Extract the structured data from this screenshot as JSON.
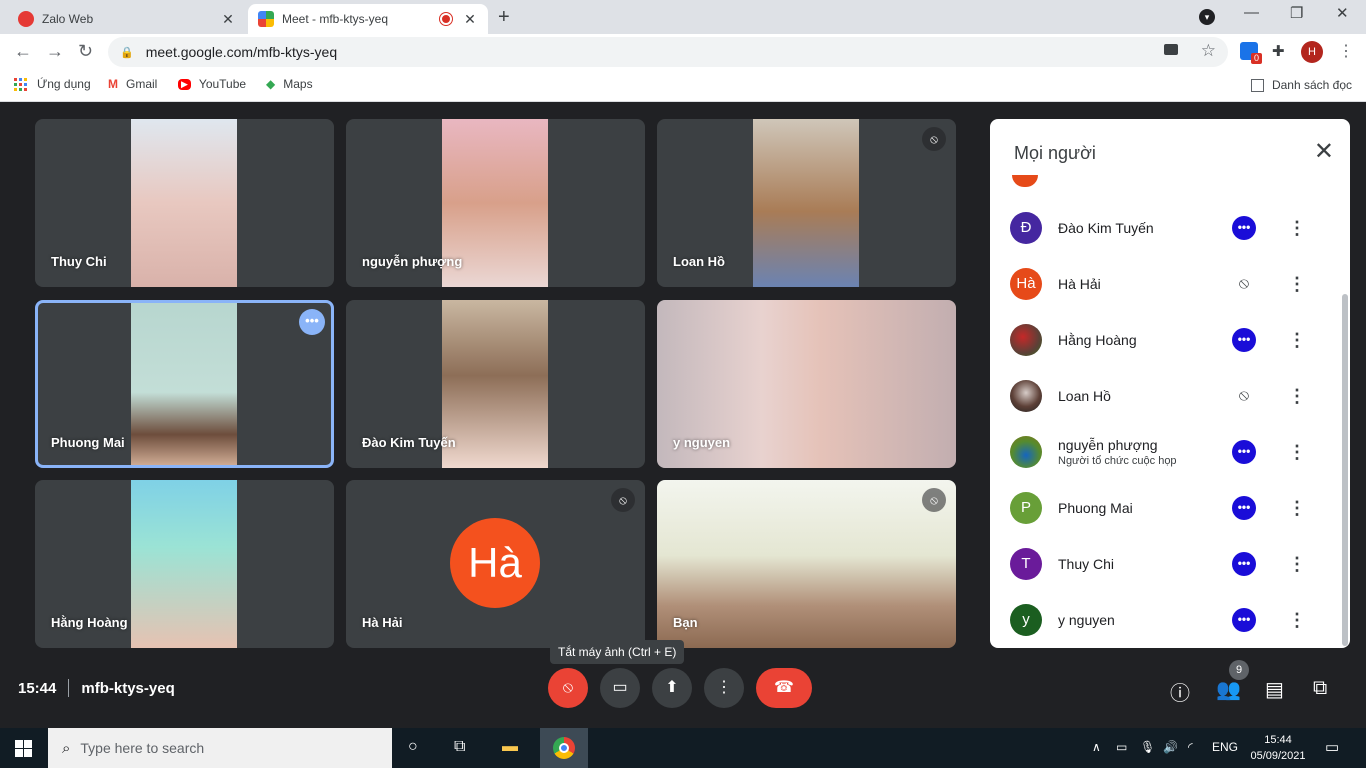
{
  "browser": {
    "tabs": [
      {
        "title": "Zalo Web",
        "active": false
      },
      {
        "title": "Meet - mfb-ktys-yeq",
        "active": true
      }
    ],
    "url": "meet.google.com/mfb-ktys-yeq",
    "extension_badge": "0",
    "profile_initial": "H",
    "bookmarks": [
      "Ứng dụng",
      "Gmail",
      "YouTube",
      "Maps"
    ],
    "reading_list": "Danh sách đọc"
  },
  "meet": {
    "tiles": [
      {
        "name": "Thuy Chi",
        "muted": false
      },
      {
        "name": "nguyễn phượng",
        "muted": false
      },
      {
        "name": "Loan Hồ",
        "muted": true
      },
      {
        "name": "Phuong Mai",
        "muted": false,
        "selected": true
      },
      {
        "name": "Đào Kim Tuyến",
        "muted": false
      },
      {
        "name": "y nguyen",
        "muted": false
      },
      {
        "name": "Hằng Hoàng",
        "muted": false
      },
      {
        "name": "Hà Hải",
        "muted": true,
        "avatar_text": "Hà"
      },
      {
        "name": "Bạn",
        "muted": true
      }
    ],
    "panel": {
      "title": "Mọi người",
      "participants": [
        {
          "name": "Đào Kim Tuyến",
          "initial": "Đ",
          "color": "#4527a0",
          "status": "more"
        },
        {
          "name": "Hà Hải",
          "initial": "Hà",
          "color": "#e64a19",
          "status": "muted"
        },
        {
          "name": "Hằng Hoàng",
          "initial": "",
          "color": "#8d6e63",
          "status": "more"
        },
        {
          "name": "Loan Hồ",
          "initial": "",
          "color": "#5d4037",
          "status": "muted"
        },
        {
          "name": "nguyễn phượng",
          "subtitle": "Người tổ chức cuộc họp",
          "initial": "",
          "color": "#558b2f",
          "status": "more"
        },
        {
          "name": "Phuong Mai",
          "initial": "P",
          "color": "#689f38",
          "status": "more"
        },
        {
          "name": "Thuy Chi",
          "initial": "T",
          "color": "#6a1b9a",
          "status": "more"
        },
        {
          "name": "y nguyen",
          "initial": "y",
          "color": "#1b5e20",
          "status": "more"
        }
      ]
    },
    "time": "15:44",
    "meeting_code": "mfb-ktys-yeq",
    "tooltip": "Tắt máy ảnh (Ctrl + E)",
    "people_count": "9"
  },
  "taskbar": {
    "search_placeholder": "Type here to search",
    "language": "ENG",
    "time": "15:44",
    "date": "05/09/2021"
  }
}
